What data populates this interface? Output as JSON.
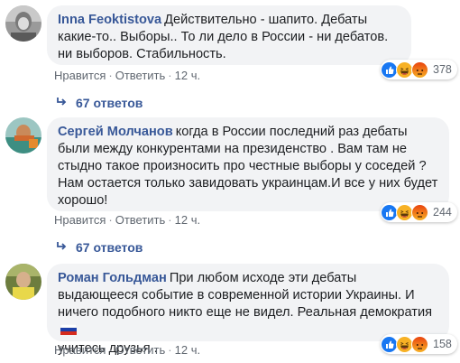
{
  "comments": [
    {
      "author": "Inna Feoktistova",
      "text": "Действительно - шапито. Дебаты какие-то.. Выборы.. То ли дело в России - ни дебатов. ни выборов. Стабильность.",
      "like_label": "Нравится",
      "reply_label": "Ответить",
      "time": "12 ч.",
      "reaction_count": "378",
      "replies_label": "67 ответов"
    },
    {
      "author": "Сергей Молчанов",
      "text": "когда в России последний раз дебаты были между конкурентами на президенство . Вам там не стыдно такое произносить про честные выборы у соседей ?Нам остается только завидовать украинцам.И все у них будет хорошо!",
      "like_label": "Нравится",
      "reply_label": "Ответить",
      "time": "12 ч.",
      "reaction_count": "244",
      "replies_label": "67 ответов"
    },
    {
      "author": "Роман Гольдман",
      "text": "При любом исходе эти дебаты выдающееся событие в современной истории Украины. И ничего подобного никто еще не видел. Реальная демократия",
      "text_tail": "учитесь друзья .",
      "like_label": "Нравится",
      "reply_label": "Ответить",
      "time": "12 ч.",
      "reaction_count": "158"
    }
  ],
  "colors": {
    "author": "#385898",
    "bubble": "#f2f3f5",
    "meta": "#606770",
    "like_blue": "#1877f2",
    "haha_yellow": "#f7b125",
    "angry_orange": "#e9710f"
  },
  "icons": {
    "reaction_like": "like-icon",
    "reaction_haha": "haha-icon",
    "reaction_angry": "angry-icon",
    "reply_arrow": "reply-arrow-icon",
    "flag": "russia-flag-icon"
  }
}
